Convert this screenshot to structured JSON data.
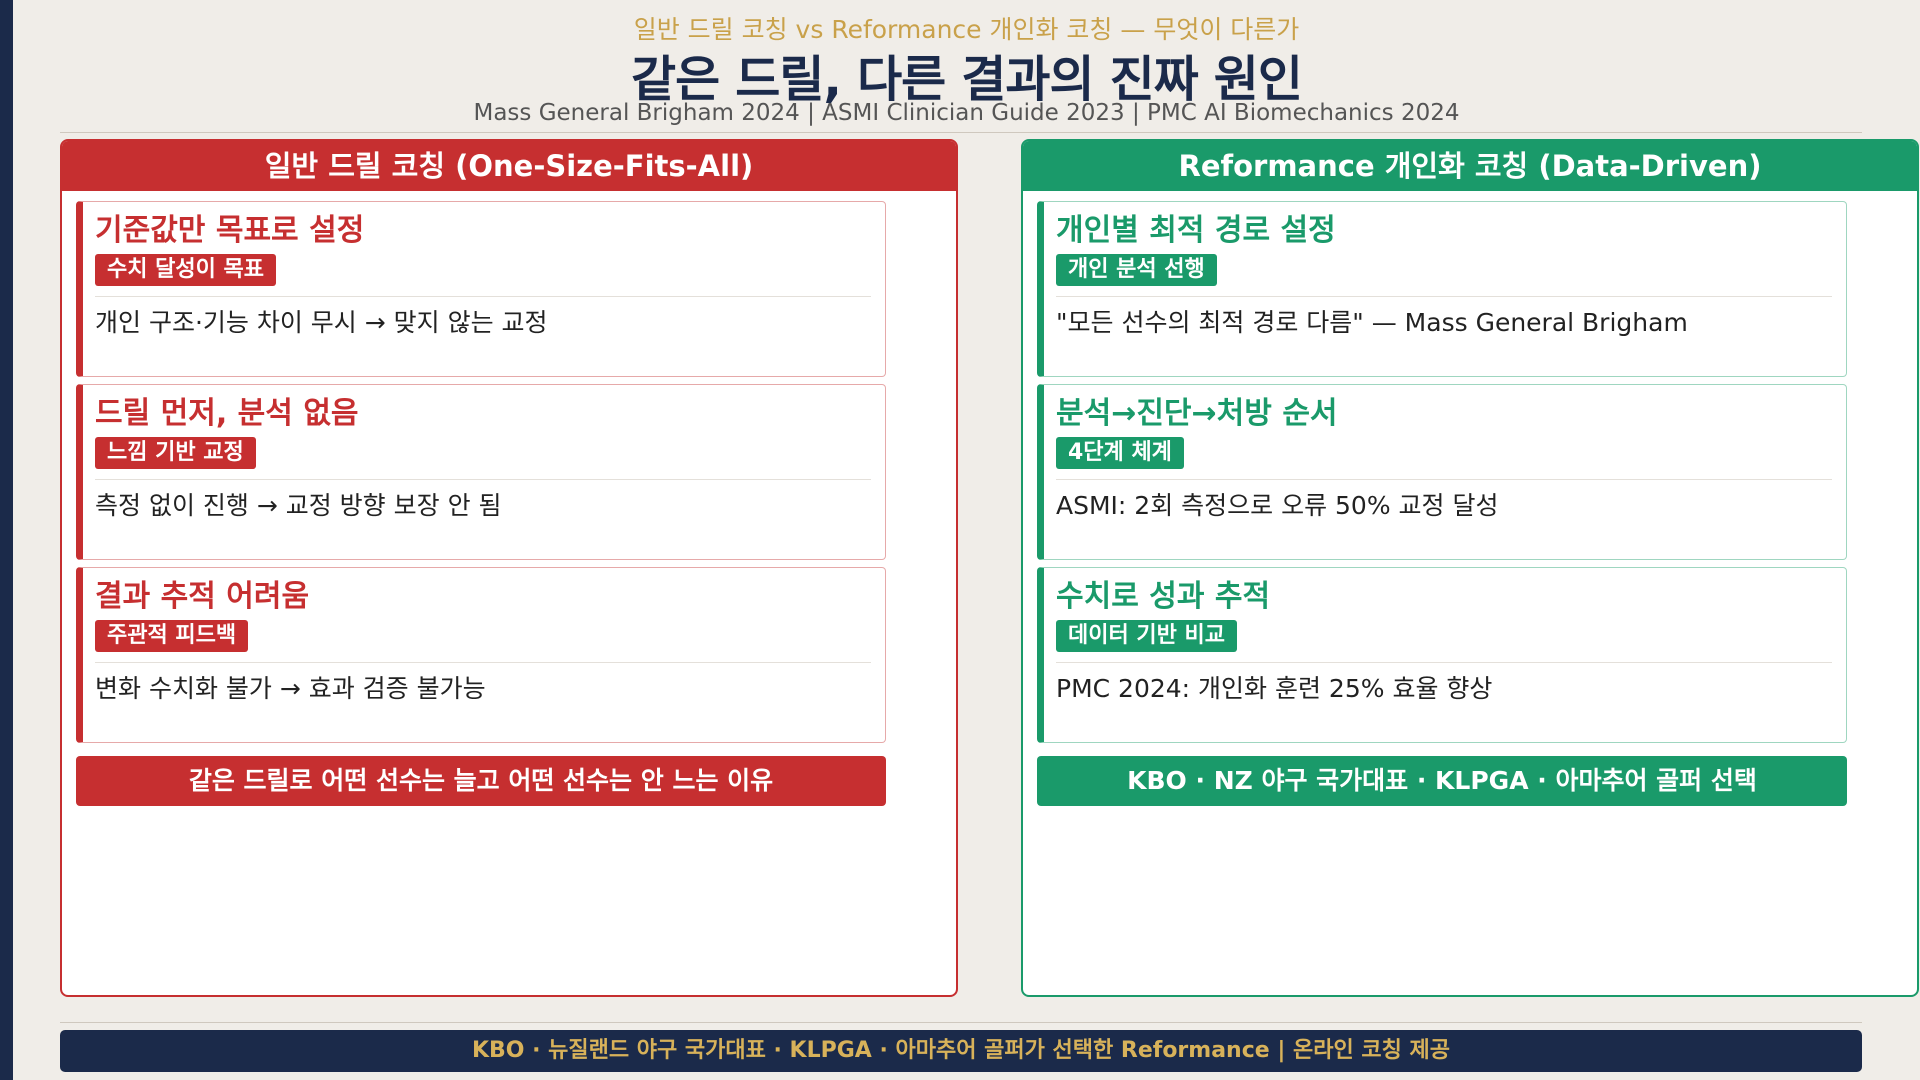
{
  "header": {
    "subtitle": "일반 드릴 코칭 vs Reformance 개인화 코칭 — 무엇이 다른가",
    "title": "같은 드릴, 다른 결과의 진짜 원인",
    "sources": "Mass General Brigham 2024  |  ASMI Clinician Guide 2023  |  PMC AI Biomechanics 2024"
  },
  "left": {
    "heading": "일반 드릴 코칭  (One-Size-Fits-All)",
    "cards": [
      {
        "title": "기준값만 목표로 설정",
        "tag": "수치 달성이 목표",
        "desc": "개인 구조·기능 차이 무시 → 맞지 않는 교정"
      },
      {
        "title": "드릴 먼저, 분석 없음",
        "tag": "느낌 기반 교정",
        "desc": "측정 없이 진행 → 교정 방향 보장 안 됨"
      },
      {
        "title": "결과 추적 어려움",
        "tag": "주관적 피드백",
        "desc": "변화 수치화 불가 → 효과 검증 불가능"
      }
    ],
    "banner": "같은 드릴로 어떤 선수는 늘고 어떤 선수는 안 느는 이유"
  },
  "right": {
    "heading": "Reformance 개인화 코칭  (Data-Driven)",
    "cards": [
      {
        "title": "개인별 최적 경로 설정",
        "tag": "개인 분석 선행",
        "desc": "\"모든 선수의 최적 경로 다름\" — Mass General Brigham"
      },
      {
        "title": "분석→진단→처방 순서",
        "tag": "4단계 체계",
        "desc": "ASMI: 2회 측정으로 오류 50% 교정 달성"
      },
      {
        "title": "수치로 성과 추적",
        "tag": "데이터 기반 비교",
        "desc": "PMC 2024: 개인화 훈련 25% 효율 향상"
      }
    ],
    "banner": "KBO · NZ 야구 국가대표 · KLPGA · 아마추어 골퍼 선택"
  },
  "footer": {
    "text": "KBO · 뉴질랜드 야구 국가대표 · KLPGA · 아마추어 골퍼가 선택한 Reformance  |  온라인 코칭 제공"
  }
}
